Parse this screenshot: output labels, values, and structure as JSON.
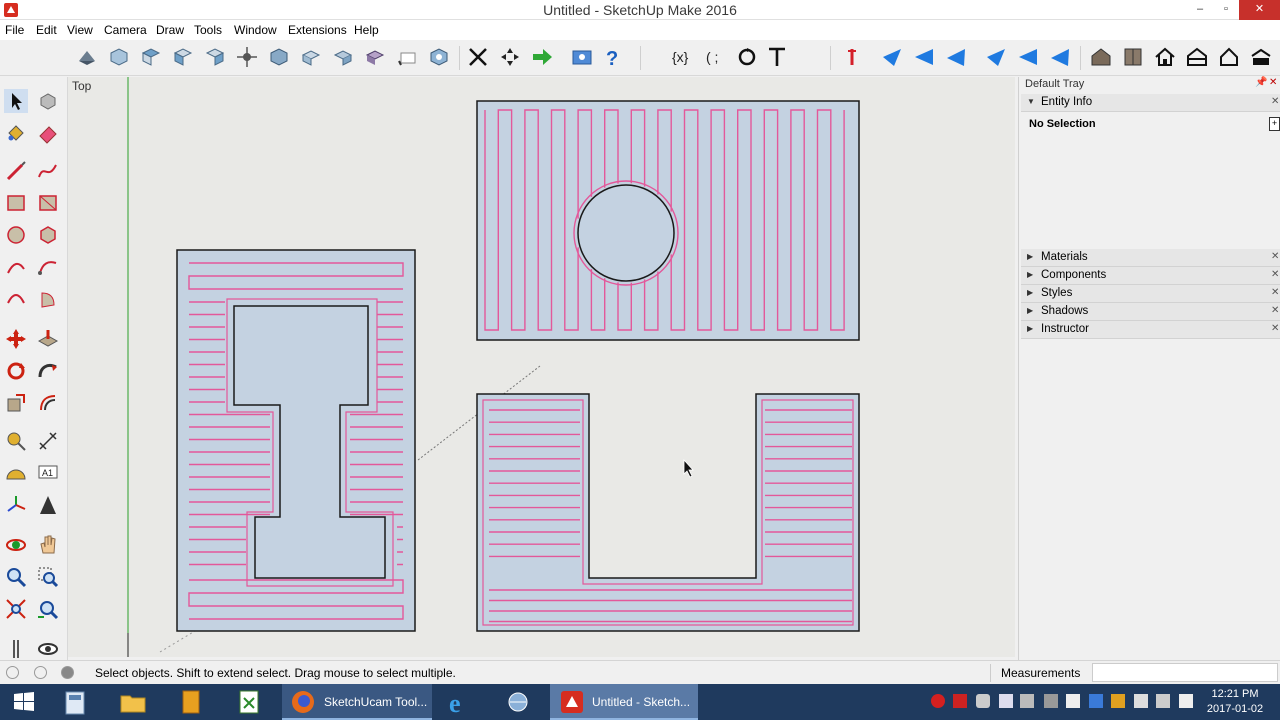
{
  "window": {
    "title": "Untitled - SketchUp Make 2016",
    "minimize": "–",
    "maximize": "▫",
    "close": "✕"
  },
  "menu": [
    "File",
    "Edit",
    "View",
    "Camera",
    "Draw",
    "Tools",
    "Window",
    "Extensions",
    "Help"
  ],
  "toolbar": {
    "icons": [
      "select-icon",
      "component-icon",
      "paint-icon",
      "eraser-icon",
      "box-icon",
      "push-icon",
      "move-icon",
      "rotate-icon",
      "scale-icon",
      "offset-icon",
      "tape-icon",
      "axes-icon",
      "orbit-icon",
      "pan-icon",
      "zoom-icon",
      "zoom-extents-icon",
      "warehouse-icon",
      "extension-icon",
      "help-icon"
    ],
    "plugin_glyphs": [
      "{x}",
      "( ;",
      "⟲",
      "T"
    ]
  },
  "viewport": {
    "scene_label": "Top",
    "colors": {
      "background": "#e9e9e6",
      "face": "#c4d2e1",
      "edge": "#1a1a1a",
      "toolpath": "#e3589a"
    }
  },
  "tray": {
    "title": "Default Tray",
    "entity_info": {
      "label": "Entity Info",
      "selection": "No Selection"
    },
    "panels": [
      "Materials",
      "Components",
      "Styles",
      "Shadows",
      "Instructor"
    ]
  },
  "status": {
    "message": "Select objects. Shift to extend select. Drag mouse to select multiple.",
    "measurements_label": "Measurements",
    "measurements_value": ""
  },
  "taskbar": {
    "apps": [
      {
        "label": "SketchUcam Tool...",
        "active": false
      },
      {
        "label": "Untitled - Sketch...",
        "active": true
      }
    ],
    "clock_time": "12:21 PM",
    "clock_date": "2017-01-02"
  }
}
